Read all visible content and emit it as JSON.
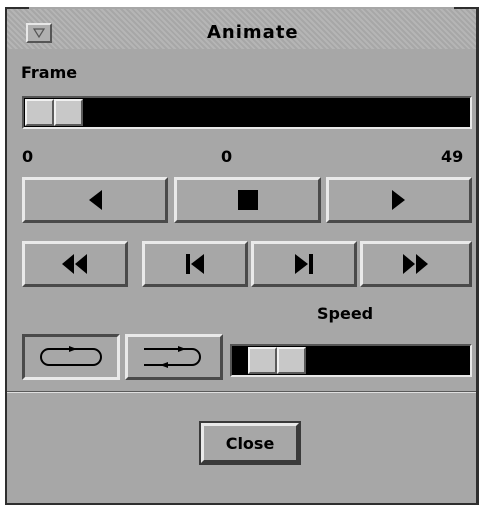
{
  "window": {
    "title": "Animate"
  },
  "frame": {
    "label": "Frame",
    "min_label": "0",
    "current_label": "0",
    "max_label": "49",
    "value": 0,
    "min": 0,
    "max": 49
  },
  "speed": {
    "label": "Speed",
    "level_fraction": 0.1
  },
  "playback": {
    "play_backward": "play-backward",
    "stop": "stop",
    "play_forward": "play-forward"
  },
  "step": {
    "rewind": "rewind-to-start",
    "step_back": "step-backward",
    "step_forward": "step-forward",
    "fast_forward": "fast-forward-to-end"
  },
  "loop_modes": {
    "selected": "loop"
  },
  "footer": {
    "close_label": "Close"
  },
  "colors": {
    "window_bg": "#a7a7a7",
    "trough": "#000000"
  }
}
